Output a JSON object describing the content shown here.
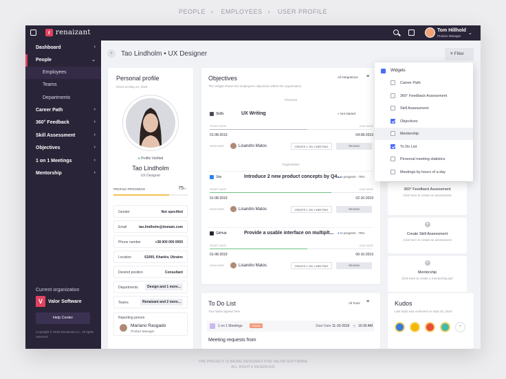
{
  "breadcrumb": [
    "PEOPLE",
    "EMPLOYEES",
    "USER PROFILE"
  ],
  "footer": [
    "THE PROJECT IS BEING DESIGNED FOR VALOR SOFTWARE",
    "ALL RIGHTS RESERVED"
  ],
  "topbar": {
    "logo_mark": "r",
    "logo": "renaizant",
    "user_name": "Tom Hillhold",
    "user_role": "Product Manager",
    "icons": [
      "menu-icon",
      "search-icon",
      "notes-icon",
      "chevron-down-icon"
    ]
  },
  "sidebar": {
    "items": [
      {
        "label": "Dashboard"
      },
      {
        "label": "People"
      },
      {
        "label": "Career Path"
      },
      {
        "label": "360° Feedback"
      },
      {
        "label": "Skill Assessment"
      },
      {
        "label": "Objectives"
      },
      {
        "label": "1 on 1 Meetings"
      },
      {
        "label": "Mentorship"
      }
    ],
    "subitems": [
      {
        "label": "Employees"
      },
      {
        "label": "Teams"
      },
      {
        "label": "Departments"
      }
    ],
    "org_label": "Current organization",
    "org_logo": "V",
    "org_name": "Valor Software",
    "help": "Help Center",
    "copyright": "Copyright © 2019 Renaizant S.L. All rights reserved."
  },
  "page": {
    "title": "Tao Lindholm • UX Designer",
    "filter": "Filter"
  },
  "profile": {
    "heading": "Personal profile",
    "hired": "Hired on May 24, 2019",
    "verified": "Profile Verified",
    "name": "Tao Lindholm",
    "role": "UX Designer",
    "progress_label": "PROFILE PROGRESS",
    "progress_value": "75",
    "progress_unit": "%",
    "progress_fraction": 0.75,
    "fields": [
      {
        "k": "Gender",
        "v": "Not specified"
      },
      {
        "k": "Email",
        "v": "tao.lindholm@domain.com"
      },
      {
        "k": "Phone number",
        "v": "+38 000 000 0000"
      },
      {
        "k": "Location",
        "v": "61000, Kharkiv, Ukraine"
      },
      {
        "k": "Desired position",
        "v": "Consultant"
      },
      {
        "k": "Departments",
        "v": "Design and 1 more..."
      },
      {
        "k": "Teams",
        "v": "Renaizant and 2 more..."
      }
    ],
    "reporting_label": "Reporting person",
    "reporting_name": "Mariano Rasgado",
    "reporting_role": "Product Manager"
  },
  "objectives": {
    "heading": "Objectives",
    "subtitle": "This widget shows the employee's objectives within the organization",
    "integrations": "All Integrations",
    "section_personal": "Personal",
    "section_org": "Organization",
    "items": [
      {
        "source": "Skills",
        "title": "UX Writing",
        "status": "Not started",
        "start_lbl": "START DATE",
        "due_lbl": "DUE DATE",
        "start": "01-08-2019",
        "due": "04-08-2019",
        "progress": 0.6,
        "created_lbl": "DESIGNER",
        "person": "Lisandro Matos",
        "meeting": "CREATE 1 ON 1 MEETING",
        "review": "REVIEW"
      },
      {
        "source": "Jira",
        "title": "Introduce 2 new product concepts by Q4...",
        "status": "In progress - 75%",
        "start_lbl": "START DATE",
        "due_lbl": "DUE DATE",
        "start": "01-08-2019",
        "due": "02-10-2019",
        "progress": 0.75,
        "created_lbl": "DESIGNER",
        "person": "Lisandro Matos",
        "meeting": "CREATE 1 ON 1 MEETING",
        "review": "REVIEW"
      },
      {
        "source": "GitHub",
        "title": "Provide a usable interface on multiplt...",
        "status": "In progress - 75%",
        "start_lbl": "START DATE",
        "due_lbl": "DUE DATE",
        "start": "01-08-2019",
        "due": "06-10-2019",
        "progress": 0.6,
        "created_lbl": "DESIGNER",
        "person": "Lisandro Matos",
        "meeting": "CREATE 1 ON 1 MEETING",
        "review": "REVIEW"
      }
    ]
  },
  "dropdown": {
    "header": "Widgets",
    "items": [
      {
        "label": "Career Path",
        "checked": false
      },
      {
        "label": "360° Feedback Assessment",
        "checked": false
      },
      {
        "label": "Skill Assessment",
        "checked": false
      },
      {
        "label": "Objectives",
        "checked": true
      },
      {
        "label": "Mentorship",
        "checked": false
      },
      {
        "label": "To Do List",
        "checked": true
      },
      {
        "label": "Personal meeting statistics",
        "checked": false
      },
      {
        "label": "Meetings by hours of a day",
        "checked": false
      }
    ]
  },
  "widgets": [
    {
      "title": "360° Feedback Assessment",
      "hint": "Click here to create an assessment"
    },
    {
      "title": "Create Skill Assessment",
      "hint": "Click here to create an assessment"
    },
    {
      "title": "Mentorship",
      "hint": "Click here to create a mentorship pair"
    }
  ],
  "todo": {
    "heading": "To Do List",
    "subtitle": "Your tasks appear here",
    "filter": "All Tools",
    "task_source": "1 on 1 Meetings",
    "task_badge": "TODAY",
    "task_date_lbl": "Start Date",
    "task_date": "11-10-2019",
    "task_time": "10:30 AM",
    "section": "Meeting requests from"
  },
  "kudos": {
    "heading": "Kudos",
    "subtitle": "Last kudo was achieved on Sept 20, 2019",
    "colors": [
      "#3a7bd5",
      "#f2b705",
      "#e94f37",
      "#44bba4"
    ]
  }
}
